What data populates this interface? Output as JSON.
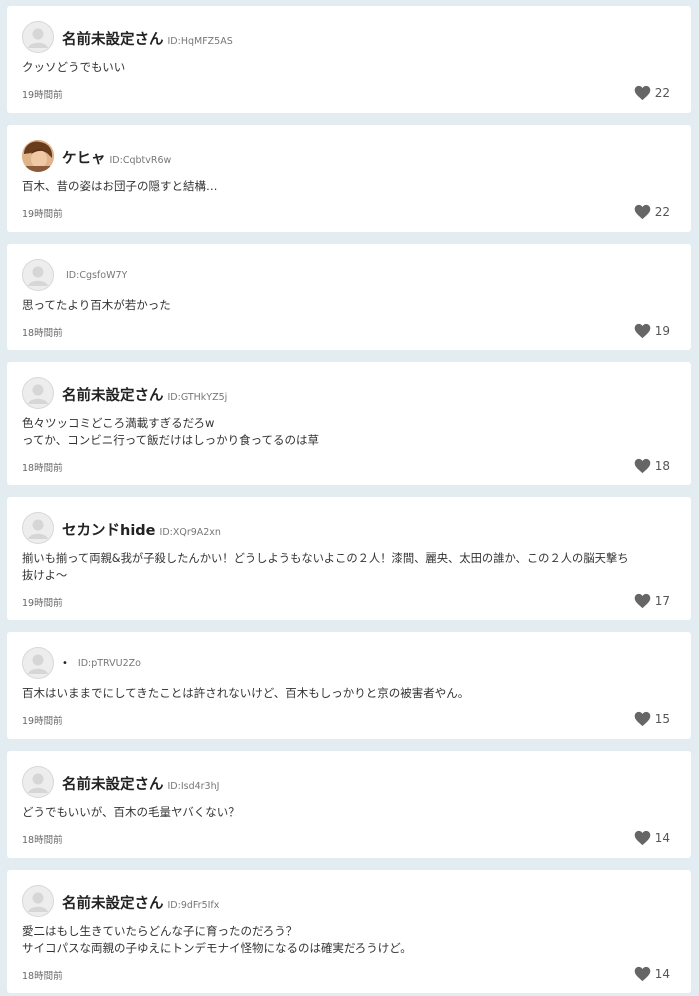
{
  "heart_color": "#666666",
  "comments": [
    {
      "name": "名前未設定さん",
      "id_label": "ID:HqMFZ5AS",
      "avatar": "default-avatar-icon",
      "lines": [
        "クッソどうでもいい"
      ],
      "time": "19時間前",
      "likes": "22"
    },
    {
      "name": "ケヒャ",
      "id_label": "ID:CqbtvR6w",
      "avatar": "photo-avatar",
      "lines": [
        "百木、昔の姿はお団子の隠すと結構…"
      ],
      "time": "19時間前",
      "likes": "22"
    },
    {
      "name": "",
      "id_label": "ID:CgsfoW7Y",
      "avatar": "default-avatar-icon",
      "lines": [
        "思ってたより百木が若かった"
      ],
      "time": "18時間前",
      "likes": "19"
    },
    {
      "name": "名前未設定さん",
      "id_label": "ID:GTHkYZ5j",
      "avatar": "default-avatar-icon",
      "lines": [
        "色々ツッコミどころ満載すぎるだろw",
        "ってか、コンビニ行って飯だけはしっかり食ってるのは草"
      ],
      "time": "18時間前",
      "likes": "18"
    },
    {
      "name": "セカンドhide",
      "id_label": "ID:XQr9A2xn",
      "avatar": "default-avatar-icon",
      "lines": [
        "揃いも揃って両親&我が子殺したんかい！どうしようもないよこの２人！漆間、麗央、太田の誰か、この２人の脳天撃ち",
        "抜けよ〜"
      ],
      "time": "19時間前",
      "likes": "17"
    },
    {
      "name": "•",
      "id_label": "ID:pTRVU2Zo",
      "avatar": "default-avatar-icon",
      "lines": [
        "百木はいままでにしてきたことは許されないけど、百木もしっかりと京の被害者やん。"
      ],
      "time": "19時間前",
      "likes": "15"
    },
    {
      "name": "名前未設定さん",
      "id_label": "ID:Isd4r3hJ",
      "avatar": "default-avatar-icon",
      "lines": [
        "どうでもいいが、百木の毛量ヤバくない？"
      ],
      "time": "18時間前",
      "likes": "14"
    },
    {
      "name": "名前未設定さん",
      "id_label": "ID:9dFr5Ifx",
      "avatar": "default-avatar-icon",
      "lines": [
        "愛二はもし生きていたらどんな子に育ったのだろう？",
        "サイコパスな両親の子ゆえにトンデモナイ怪物になるのは確実だろうけど。"
      ],
      "time": "18時間前",
      "likes": "14"
    }
  ]
}
